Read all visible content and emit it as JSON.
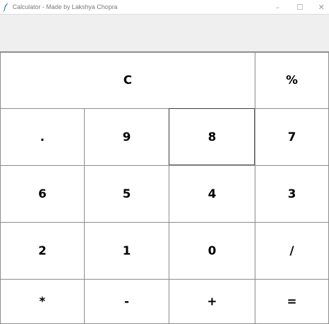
{
  "window": {
    "title": "Calculator - Made by Lakshya Chopra",
    "app_icon": "feather-icon",
    "controls": {
      "minimize": "–",
      "maximize": "☐",
      "close": "✕"
    }
  },
  "display": {
    "value": ""
  },
  "keypad": {
    "rows": [
      [
        "C",
        "%"
      ],
      [
        ".",
        "9",
        "8",
        "7"
      ],
      [
        "6",
        "5",
        "4",
        "3"
      ],
      [
        "2",
        "1",
        "0",
        "/"
      ],
      [
        "*",
        "-",
        "+",
        "="
      ]
    ]
  }
}
